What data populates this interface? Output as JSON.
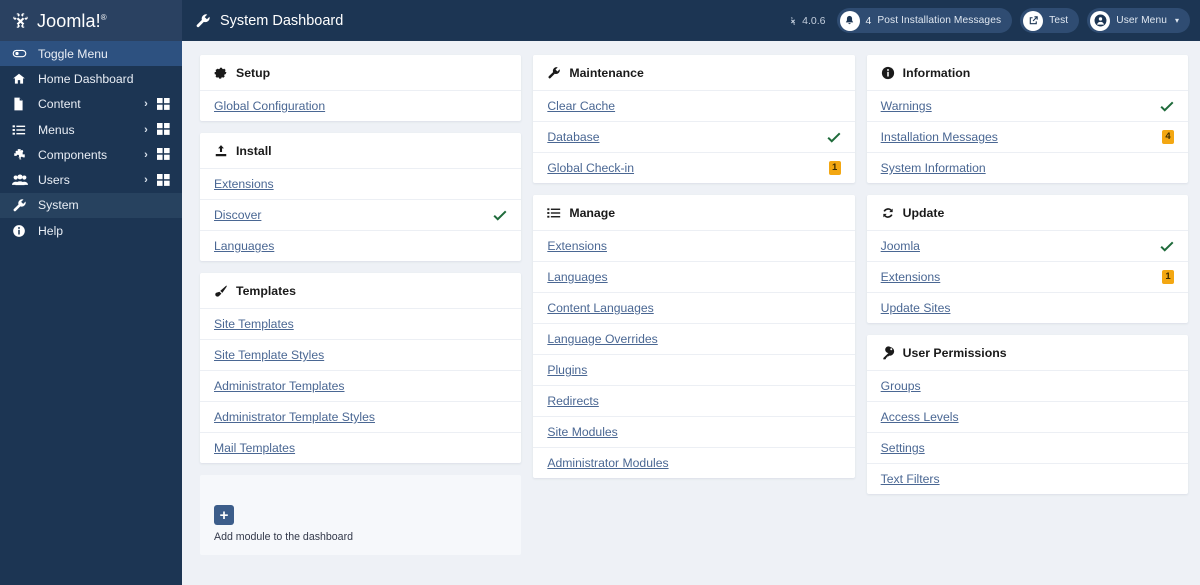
{
  "brand": {
    "name": "Joomla!",
    "logo_icon": "joomla-logo-icon"
  },
  "sidebar": {
    "items": [
      {
        "label": "Toggle Menu",
        "icon": "toggle-icon",
        "state": "toggle"
      },
      {
        "label": "Home Dashboard",
        "icon": "home-icon",
        "state": "normal"
      },
      {
        "label": "Content",
        "icon": "document-icon",
        "state": "normal",
        "chevron": "›",
        "grid": true
      },
      {
        "label": "Menus",
        "icon": "list-icon",
        "state": "normal",
        "chevron": "›",
        "grid": true
      },
      {
        "label": "Components",
        "icon": "puzzle-icon",
        "state": "normal",
        "chevron": "›",
        "grid": true
      },
      {
        "label": "Users",
        "icon": "users-icon",
        "state": "normal",
        "chevron": "›",
        "grid": true
      },
      {
        "label": "System",
        "icon": "wrench-icon",
        "state": "active"
      },
      {
        "label": "Help",
        "icon": "info-icon",
        "state": "normal"
      }
    ]
  },
  "header": {
    "title": "System Dashboard",
    "title_icon": "wrench-icon",
    "version": "4.0.6",
    "version_icon": "joomla-mark-icon",
    "messages": {
      "icon": "bell-icon",
      "count": "4",
      "label": "Post Installation Messages"
    },
    "preview": {
      "icon": "external-link-icon",
      "label": "Test"
    },
    "user_menu": {
      "icon": "user-icon",
      "label": "User Menu",
      "caret": "▾"
    }
  },
  "colors": {
    "sidebar_bg": "#1c3553",
    "accent": "#2d5180",
    "link": "#4a6793",
    "badge_warning": "#f3a712",
    "check_ok": "#1f6b3b"
  },
  "board": {
    "columns": [
      {
        "cards": [
          {
            "title": "Setup",
            "icon": "gear-icon",
            "rows": [
              {
                "label": "Global Configuration",
                "status": "none"
              }
            ]
          },
          {
            "title": "Install",
            "icon": "upload-icon",
            "rows": [
              {
                "label": "Extensions",
                "status": "none"
              },
              {
                "label": "Discover",
                "status": "check"
              },
              {
                "label": "Languages",
                "status": "none"
              }
            ]
          },
          {
            "title": "Templates",
            "icon": "brush-icon",
            "rows": [
              {
                "label": "Site Templates",
                "status": "none"
              },
              {
                "label": "Site Template Styles",
                "status": "none"
              },
              {
                "label": "Administrator Templates",
                "status": "none"
              },
              {
                "label": "Administrator Template Styles",
                "status": "none"
              },
              {
                "label": "Mail Templates",
                "status": "none"
              }
            ]
          }
        ],
        "add_module": {
          "label": "Add module to the dashboard",
          "icon": "plus-icon",
          "plus": "+"
        }
      },
      {
        "cards": [
          {
            "title": "Maintenance",
            "icon": "wrench-icon",
            "rows": [
              {
                "label": "Clear Cache",
                "status": "none"
              },
              {
                "label": "Database",
                "status": "check"
              },
              {
                "label": "Global Check-in",
                "status": "badge",
                "badge": "1"
              }
            ]
          },
          {
            "title": "Manage",
            "icon": "list-icon",
            "rows": [
              {
                "label": "Extensions",
                "status": "none"
              },
              {
                "label": "Languages",
                "status": "none"
              },
              {
                "label": "Content Languages",
                "status": "none"
              },
              {
                "label": "Language Overrides",
                "status": "none"
              },
              {
                "label": "Plugins",
                "status": "none"
              },
              {
                "label": "Redirects",
                "status": "none"
              },
              {
                "label": "Site Modules",
                "status": "none"
              },
              {
                "label": "Administrator Modules",
                "status": "none"
              }
            ]
          }
        ]
      },
      {
        "cards": [
          {
            "title": "Information",
            "icon": "info-icon",
            "rows": [
              {
                "label": "Warnings",
                "status": "check"
              },
              {
                "label": "Installation Messages",
                "status": "badge",
                "badge": "4"
              },
              {
                "label": "System Information",
                "status": "none"
              }
            ]
          },
          {
            "title": "Update",
            "icon": "refresh-icon",
            "rows": [
              {
                "label": "Joomla",
                "status": "check"
              },
              {
                "label": "Extensions",
                "status": "badge",
                "badge": "1"
              },
              {
                "label": "Update Sites",
                "status": "none"
              }
            ]
          },
          {
            "title": "User Permissions",
            "icon": "key-icon",
            "rows": [
              {
                "label": "Groups",
                "status": "none"
              },
              {
                "label": "Access Levels",
                "status": "none"
              },
              {
                "label": "Settings",
                "status": "none"
              },
              {
                "label": "Text Filters",
                "status": "none"
              }
            ]
          }
        ]
      }
    ]
  }
}
